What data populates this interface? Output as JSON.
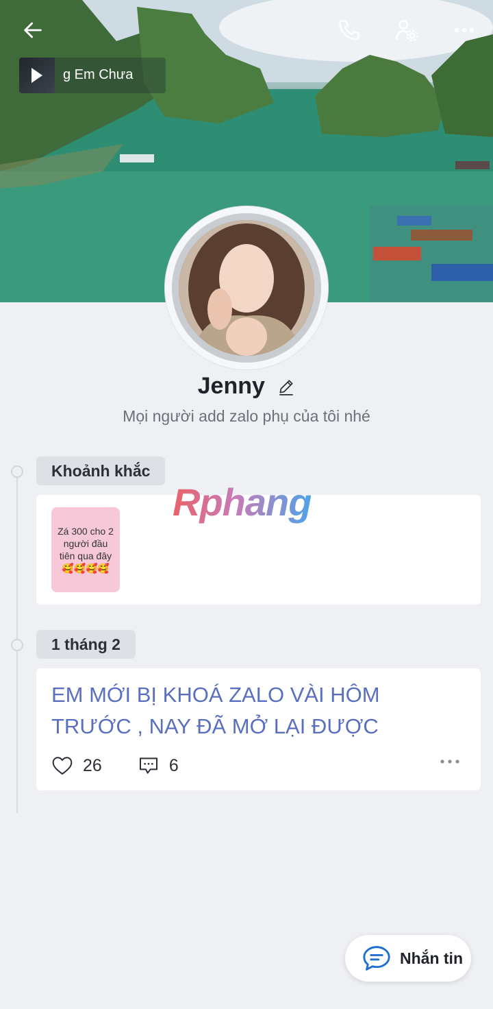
{
  "header": {
    "back_icon": "arrow-left-icon",
    "call_icon": "phone-icon",
    "settings_icon": "user-settings-icon",
    "more_icon": "more-horizontal-icon"
  },
  "music": {
    "title": "g Em Chưa",
    "play_icon": "play-icon"
  },
  "profile": {
    "name": "Jenny",
    "bio": "Mọi người add zalo phụ của tôi nhé"
  },
  "watermark": "Rphang",
  "moments": {
    "label": "Khoảnh khắc",
    "items": [
      {
        "text": "Zá 300 cho 2 người đầu tiên qua đây 🥰🥰🥰🥰"
      }
    ]
  },
  "post": {
    "date_label": "1 tháng 2",
    "text": "EM MỚI BỊ KHOÁ ZALO VÀI HÔM TRƯỚC , NAY ĐÃ MỞ LẠI ĐƯỢC",
    "likes": "26",
    "comments": "6"
  },
  "fab": {
    "label": "Nhắn tin"
  },
  "colors": {
    "post_text": "#5a6fbf",
    "background": "#eef0f4",
    "moment_card": "#f7c8d8"
  }
}
